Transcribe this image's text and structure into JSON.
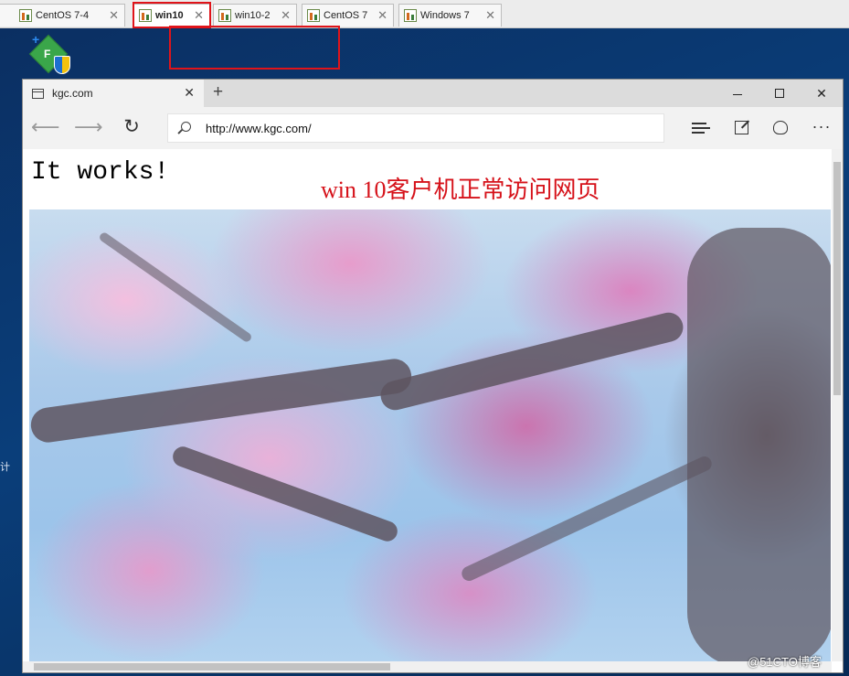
{
  "vm_tabs": [
    {
      "label": "CentOS 7-4",
      "active": false
    },
    {
      "label": "win10",
      "active": true
    },
    {
      "label": "win10-2",
      "active": false
    },
    {
      "label": "CentOS 7",
      "active": false
    },
    {
      "label": "Windows 7",
      "active": false
    }
  ],
  "desktop": {
    "icon_letter": "F",
    "left_edge_text": "计"
  },
  "browser": {
    "tab_title": "kgc.com",
    "new_tab_label": "+",
    "url": "http://www.kgc.com/",
    "more_label": "···"
  },
  "page": {
    "heading": "It works!"
  },
  "annotation": "win 10客户机正常访问网页",
  "watermark": "@51CTO博客",
  "colors": {
    "highlight_box": "#e0141a",
    "annotation_text": "#d6121a",
    "desktop_bg": "#0a3e7a"
  },
  "icons": [
    "page-icon",
    "back-arrow-icon",
    "forward-arrow-icon",
    "refresh-icon",
    "search-icon",
    "hub-icon",
    "web-note-icon",
    "share-icon",
    "more-icon"
  ]
}
